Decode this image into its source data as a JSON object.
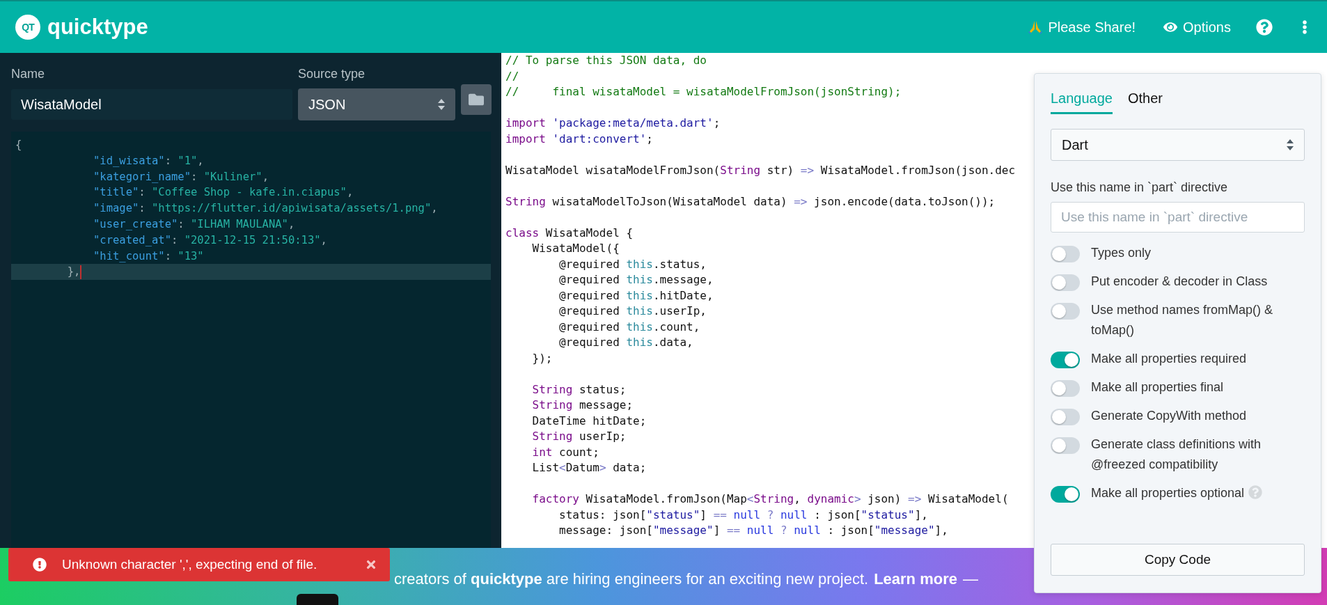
{
  "header": {
    "logo_mark": "QT",
    "brand": "quicktype",
    "share": "Please Share!",
    "options": "Options"
  },
  "source": {
    "name_label": "Name",
    "name_value": "WisataModel",
    "type_label": "Source type",
    "type_value": "JSON",
    "editor": [
      {
        "current": false,
        "tokens": [
          {
            "kind": "punct",
            "text": "{"
          }
        ]
      },
      {
        "current": false,
        "tokens": [
          {
            "kind": "key",
            "text": "            \"id_wisata\""
          },
          {
            "kind": "punct",
            "text": ": "
          },
          {
            "kind": "string",
            "text": "\"1\""
          },
          {
            "kind": "punct",
            "text": ","
          }
        ]
      },
      {
        "current": false,
        "tokens": [
          {
            "kind": "key",
            "text": "            \"kategori_name\""
          },
          {
            "kind": "punct",
            "text": ": "
          },
          {
            "kind": "string",
            "text": "\"Kuliner\""
          },
          {
            "kind": "punct",
            "text": ","
          }
        ]
      },
      {
        "current": false,
        "tokens": [
          {
            "kind": "key",
            "text": "            \"title\""
          },
          {
            "kind": "punct",
            "text": ": "
          },
          {
            "kind": "string",
            "text": "\"Coffee Shop - kafe.in.ciapus\""
          },
          {
            "kind": "punct",
            "text": ","
          }
        ]
      },
      {
        "current": false,
        "tokens": [
          {
            "kind": "key",
            "text": "            \"image\""
          },
          {
            "kind": "punct",
            "text": ": "
          },
          {
            "kind": "string",
            "text": "\"https://flutter.id/apiwisata/assets/1.png\""
          },
          {
            "kind": "punct",
            "text": ","
          }
        ]
      },
      {
        "current": false,
        "tokens": [
          {
            "kind": "key",
            "text": "            \"user_create\""
          },
          {
            "kind": "punct",
            "text": ": "
          },
          {
            "kind": "string",
            "text": "\"ILHAM MAULANA\""
          },
          {
            "kind": "punct",
            "text": ","
          }
        ]
      },
      {
        "current": false,
        "tokens": [
          {
            "kind": "key",
            "text": "            \"created_at\""
          },
          {
            "kind": "punct",
            "text": ": "
          },
          {
            "kind": "string",
            "text": "\"2021-12-15 21:50:13\""
          },
          {
            "kind": "punct",
            "text": ","
          }
        ]
      },
      {
        "current": false,
        "tokens": [
          {
            "kind": "key",
            "text": "            \"hit_count\""
          },
          {
            "kind": "punct",
            "text": ": "
          },
          {
            "kind": "string",
            "text": "\"13\""
          }
        ]
      },
      {
        "current": true,
        "tokens": [
          {
            "kind": "punct",
            "text": "        },"
          }
        ]
      }
    ]
  },
  "code": [
    {
      "kind": "code",
      "tokens": [
        {
          "kind": "comment",
          "text": "// To parse this JSON data, do"
        }
      ]
    },
    {
      "kind": "code",
      "tokens": [
        {
          "kind": "comment",
          "text": "//"
        }
      ]
    },
    {
      "kind": "code",
      "tokens": [
        {
          "kind": "comment",
          "text": "//     final wisataModel = wisataModelFromJson(jsonString);"
        }
      ]
    },
    {
      "kind": "blank"
    },
    {
      "kind": "code",
      "tokens": [
        {
          "kind": "keyword",
          "text": "import"
        },
        {
          "kind": "string",
          "text": " 'package:meta/meta.dart'"
        },
        {
          "kind": "plain",
          "text": ";"
        }
      ]
    },
    {
      "kind": "code",
      "tokens": [
        {
          "kind": "keyword",
          "text": "import"
        },
        {
          "kind": "string",
          "text": " 'dart:convert'"
        },
        {
          "kind": "plain",
          "text": ";"
        }
      ]
    },
    {
      "kind": "blank"
    },
    {
      "kind": "code",
      "tokens": [
        {
          "kind": "plain",
          "text": "WisataModel wisataModelFromJson("
        },
        {
          "kind": "keyword",
          "text": "String"
        },
        {
          "kind": "plain",
          "text": " str) "
        },
        {
          "kind": "op",
          "text": "=>"
        },
        {
          "kind": "plain",
          "text": " WisataModel.fromJson(json.dec"
        }
      ]
    },
    {
      "kind": "blank"
    },
    {
      "kind": "code",
      "tokens": [
        {
          "kind": "keyword",
          "text": "String"
        },
        {
          "kind": "plain",
          "text": " wisataModelToJson(WisataModel data) "
        },
        {
          "kind": "op",
          "text": "=>"
        },
        {
          "kind": "plain",
          "text": " json.encode(data.toJson());"
        }
      ]
    },
    {
      "kind": "blank"
    },
    {
      "kind": "code",
      "tokens": [
        {
          "kind": "keyword",
          "text": "class"
        },
        {
          "kind": "plain",
          "text": " WisataModel {"
        }
      ]
    },
    {
      "kind": "code",
      "tokens": [
        {
          "kind": "plain",
          "text": "    WisataModel({"
        }
      ]
    },
    {
      "kind": "code",
      "tokens": [
        {
          "kind": "plain",
          "text": "        @required "
        },
        {
          "kind": "this",
          "text": "this"
        },
        {
          "kind": "plain",
          "text": ".status,"
        }
      ]
    },
    {
      "kind": "code",
      "tokens": [
        {
          "kind": "plain",
          "text": "        @required "
        },
        {
          "kind": "this",
          "text": "this"
        },
        {
          "kind": "plain",
          "text": ".message,"
        }
      ]
    },
    {
      "kind": "code",
      "tokens": [
        {
          "kind": "plain",
          "text": "        @required "
        },
        {
          "kind": "this",
          "text": "this"
        },
        {
          "kind": "plain",
          "text": ".hitDate,"
        }
      ]
    },
    {
      "kind": "code",
      "tokens": [
        {
          "kind": "plain",
          "text": "        @required "
        },
        {
          "kind": "this",
          "text": "this"
        },
        {
          "kind": "plain",
          "text": ".userIp,"
        }
      ]
    },
    {
      "kind": "code",
      "tokens": [
        {
          "kind": "plain",
          "text": "        @required "
        },
        {
          "kind": "this",
          "text": "this"
        },
        {
          "kind": "plain",
          "text": ".count,"
        }
      ]
    },
    {
      "kind": "code",
      "tokens": [
        {
          "kind": "plain",
          "text": "        @required "
        },
        {
          "kind": "this",
          "text": "this"
        },
        {
          "kind": "plain",
          "text": ".data,"
        }
      ]
    },
    {
      "kind": "code",
      "tokens": [
        {
          "kind": "plain",
          "text": "    });"
        }
      ]
    },
    {
      "kind": "blank"
    },
    {
      "kind": "code",
      "tokens": [
        {
          "kind": "keyword",
          "text": "    String"
        },
        {
          "kind": "plain",
          "text": " status;"
        }
      ]
    },
    {
      "kind": "code",
      "tokens": [
        {
          "kind": "keyword",
          "text": "    String"
        },
        {
          "kind": "plain",
          "text": " message;"
        }
      ]
    },
    {
      "kind": "code",
      "tokens": [
        {
          "kind": "plain",
          "text": "    DateTime hitDate;"
        }
      ]
    },
    {
      "kind": "code",
      "tokens": [
        {
          "kind": "keyword",
          "text": "    String"
        },
        {
          "kind": "plain",
          "text": " userIp;"
        }
      ]
    },
    {
      "kind": "code",
      "tokens": [
        {
          "kind": "keyword",
          "text": "    int"
        },
        {
          "kind": "plain",
          "text": " count;"
        }
      ]
    },
    {
      "kind": "code",
      "tokens": [
        {
          "kind": "plain",
          "text": "    List"
        },
        {
          "kind": "op",
          "text": "<"
        },
        {
          "kind": "plain",
          "text": "Datum"
        },
        {
          "kind": "op",
          "text": ">"
        },
        {
          "kind": "plain",
          "text": " data;"
        }
      ]
    },
    {
      "kind": "blank"
    },
    {
      "kind": "code",
      "tokens": [
        {
          "kind": "keyword",
          "text": "    factory"
        },
        {
          "kind": "plain",
          "text": " WisataModel.fromJson(Map"
        },
        {
          "kind": "op",
          "text": "<"
        },
        {
          "kind": "keyword",
          "text": "String"
        },
        {
          "kind": "plain",
          "text": ", "
        },
        {
          "kind": "keyword",
          "text": "dynamic"
        },
        {
          "kind": "op",
          "text": ">"
        },
        {
          "kind": "plain",
          "text": " json) "
        },
        {
          "kind": "op",
          "text": "=>"
        },
        {
          "kind": "plain",
          "text": " WisataModel("
        }
      ]
    },
    {
      "kind": "code",
      "tokens": [
        {
          "kind": "plain",
          "text": "        status: json["
        },
        {
          "kind": "string",
          "text": "\"status\""
        },
        {
          "kind": "plain",
          "text": "] "
        },
        {
          "kind": "op",
          "text": "=="
        },
        {
          "kind": "null",
          "text": " null"
        },
        {
          "kind": "op",
          "text": " ?"
        },
        {
          "kind": "null",
          "text": " null"
        },
        {
          "kind": "plain",
          "text": " : json["
        },
        {
          "kind": "string",
          "text": "\"status\""
        },
        {
          "kind": "plain",
          "text": "],"
        }
      ]
    },
    {
      "kind": "code",
      "tokens": [
        {
          "kind": "plain",
          "text": "        message: json["
        },
        {
          "kind": "string",
          "text": "\"message\""
        },
        {
          "kind": "plain",
          "text": "] "
        },
        {
          "kind": "op",
          "text": "=="
        },
        {
          "kind": "null",
          "text": " null"
        },
        {
          "kind": "op",
          "text": " ?"
        },
        {
          "kind": "null",
          "text": " null"
        },
        {
          "kind": "plain",
          "text": " : json["
        },
        {
          "kind": "string",
          "text": "\"message\""
        },
        {
          "kind": "plain",
          "text": "],"
        }
      ]
    }
  ],
  "options": {
    "tabs": [
      {
        "label": "Language",
        "selected": true
      },
      {
        "label": "Other",
        "selected": false
      }
    ],
    "language": "Dart",
    "part_label": "Use this name in `part` directive",
    "part_placeholder": "Use this name in `part` directive",
    "toggles": [
      {
        "label": "Types only",
        "on": false,
        "help": false
      },
      {
        "label": "Put encoder & decoder in Class",
        "on": false,
        "help": false
      },
      {
        "label": "Use method names fromMap() & toMap()",
        "on": false,
        "help": false
      },
      {
        "label": "Make all properties required",
        "on": true,
        "help": false
      },
      {
        "label": "Make all properties final",
        "on": false,
        "help": false
      },
      {
        "label": "Generate CopyWith method",
        "on": false,
        "help": false
      },
      {
        "label": "Generate class definitions with @freezed compatibility",
        "on": false,
        "help": false
      },
      {
        "label": "Make all properties optional",
        "on": true,
        "help": true
      }
    ],
    "copy_button": "Copy Code"
  },
  "banner": {
    "text": "creators of **quicktype** are hiring engineers for an exciting new project.",
    "link": "Learn more",
    "trailing": "—"
  },
  "toast": {
    "message": "Unknown character ',', expecting end of file."
  }
}
